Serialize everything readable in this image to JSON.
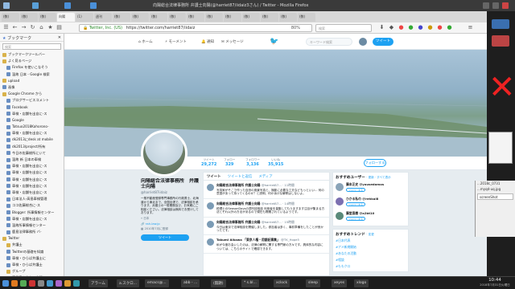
{
  "window": {
    "title": "向陽総合法律事務所 弁護士向陽(@harriet87/iidaiz3さん) / Twitter - Mozilla Firefox"
  },
  "tabs": [
    "(数)",
    "(数)",
    "(数)",
    "向陽",
    "(1)",
    "週刊",
    "(数)",
    "(数)",
    "(数)",
    "(数)",
    "(数)",
    "(数)",
    "(数)",
    "(数)",
    "(数)",
    "(数)",
    "(数)"
  ],
  "url": "https://twitter.com/harriet87/iidaiz",
  "url_short": "Twitter, Inc. (US)",
  "search_placeholder": "検索",
  "zoom": "80%",
  "sidebar": {
    "title": "ブックマーク",
    "search_placeholder": "検索",
    "items": [
      "ブックマークツールバー",
      "よく見るページ",
      "Firefox を使いこなそう",
      "温故 日本 - Google 検索",
      "upload",
      "画像",
      "Google Chrome から",
      "ブログサービスコメント",
      "Facebook",
      "車検・店舗を出自に-ス",
      "Google",
      "Tatsuo2018Kahorono-",
      "車検・店舗を出自に-ス",
      "dk2013にdesk at mobile",
      "dk2013/project/所有",
      "今日の佐藤総所にいて",
      "温故 新 日本の車検",
      "車検・店舗を出自に-ス",
      "車検・店舗を出自に-ス",
      "車検・店舗を出自に-ス",
      "車検・店舗を出自に-ス",
      "車検・店舗を出自に-ス",
      "日本法人-高島車検管理",
      "ココ佐藤総合に-ス",
      "Blogger: 所事情報センター",
      "車検・店舗を出自に-ス",
      "温故所事情報センター",
      "鹿島法律事務所 バ-",
      "Twitter",
      "弁護士",
      "Twitterの基礎を知識",
      "車検・ひらば弁護士に",
      "車検・ひらば弁護士",
      "グループ",
      "実業家あらかの出張"
    ]
  },
  "twitter_nav": {
    "home": "ホーム",
    "moments": "モーメント",
    "notifications": "通知",
    "messages": "メッセージ",
    "search_placeholder": "キーワード検索",
    "tweet_button": "ツイート"
  },
  "stats": [
    {
      "label": "ツイート",
      "value": "29,272"
    },
    {
      "label": "フォロー",
      "value": "329"
    },
    {
      "label": "フォロワー",
      "value": "3,136"
    },
    {
      "label": "いいね",
      "value": "35,915"
    }
  ],
  "follow_button": "フォローする",
  "profile": {
    "name": "向陽総合法律事務所　弁護士向陽",
    "handle": "@harriet87iidaiz",
    "bio": "一般不動産登録専門事務所の行政書士、北海道から東北まで、全国出張で、法律相談を承ります。弁護士の一般業務及び、お気軽にご相談ください。法律相談は無料でお受けしております。",
    "location": "日本",
    "link": "nsh-law.jp",
    "joined": "2010年7月に登録",
    "tweet_button": "ツイート"
  },
  "timeline": {
    "tabs": [
      "ツイート",
      "ツイートと返信",
      "メディア"
    ],
    "tweets": [
      {
        "author": "向陽総合法律事務所 弁護士向陽",
        "handle": "@harriet87... · 11時間",
        "text": "写真家がそこで作った自然の風景写真と、撮影に必要な工夫などもっといい... 何の意図があって持ってくるのか？と説明、何か余计な解釈はしないよ。"
      },
      {
        "author": "向陽総合法律事務所 弁護士向陽",
        "handle": "@harriet87... · 14時間",
        "text": "税理士のSeasonDaysの週刊誌相談 利用者を募集してもうますます注目が集まる方法とそれ以外の方法があるので現在も開業されているようです。"
      },
      {
        "author": "向陽総合法律事務所 弁護士向陽",
        "handle": "@harriet87... · 15時間",
        "text": "今日は東京で法律相談を開催しました。参加者は多く、事前準備をしたことが良かったです。"
      },
      {
        "author": "Takumi Aikawa 「東京人権・用語記事集」",
        "handle": "@TK_Hope5",
        "text": "私が今度お会いしたのは、法律の解釈に関する専門家の方々です。具体的な内容については、こちらのサイトで確認できます。"
      }
    ]
  },
  "suggestions": {
    "title": "おすすめユーザー",
    "links": "· 更新 · すべて表示",
    "users": [
      {
        "name": "藤本正史 @yousedomos",
        "button": "フォローする"
      },
      {
        "name": "ひかる私の @rehkal8",
        "button": "フォローする"
      },
      {
        "name": "藤堂直樹 @a2bt10",
        "button": "フォローする"
      }
    ]
  },
  "trends": {
    "title": "おすすめトレンド",
    "links": "· 変更",
    "items": [
      "#日本代表",
      "#アメ新規開始",
      "#あなたの活動",
      "#相談",
      "#ももクロ"
    ]
  },
  "side_window": {
    "lines": [
      "...2018c_0731",
      "...myqd-uq.jpg",
      "screenShot"
    ]
  },
  "taskbar": {
    "apps": [
      "アラーム",
      "a.スクロ...",
      "emacs@...",
      "abb - ...",
      "(無題)",
      "* s.bl...",
      "xclock",
      "sleep",
      "xeyes",
      "xlogo"
    ],
    "time": "10:44",
    "date": "2018年7月31日火曜日"
  }
}
